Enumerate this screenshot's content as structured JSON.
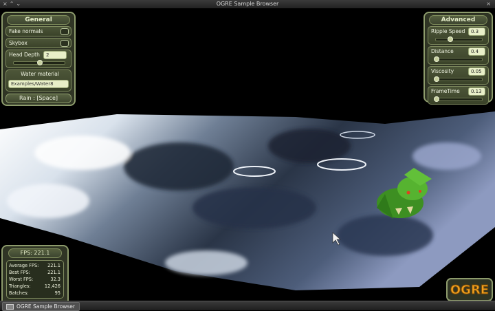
{
  "window": {
    "title": "OGRE Sample Browser"
  },
  "general": {
    "title": "General",
    "fake_normals": {
      "label": "Fake normals",
      "checked": false
    },
    "skybox": {
      "label": "Skybox",
      "checked": false
    },
    "head_depth": {
      "label": "Head Depth",
      "value": "2",
      "level": 0.5
    },
    "water_material": {
      "label": "Water material",
      "value": "Examples/Water8"
    },
    "rain_button": "Rain : [Space]"
  },
  "advanced": {
    "title": "Advanced",
    "ripple_speed": {
      "label": "Ripple Speed",
      "value": "0.3",
      "level": 0.3
    },
    "distance": {
      "label": "Distance",
      "value": "0.4",
      "level": 0.0
    },
    "viscosity": {
      "label": "Viscosity",
      "value": "0.05",
      "level": 0.0
    },
    "frame_time": {
      "label": "FrameTime",
      "value": "0.13",
      "level": 0.0
    }
  },
  "stats": {
    "fps": "FPS: 221.1",
    "average_label": "Average FPS:",
    "average_value": "221.1",
    "best_label": "Best FPS:",
    "best_value": "221.1",
    "worst_label": "Worst FPS:",
    "worst_value": "32.3",
    "triangles_label": "Triangles:",
    "triangles_value": "12,426",
    "batches_label": "Batches:",
    "batches_value": "95"
  },
  "logo": {
    "text": "OGRE"
  },
  "taskbar": {
    "item": "OGRE Sample Browser"
  },
  "colors": {
    "panel_bg": "#343a28",
    "panel_border": "#8d9b6c",
    "field_bg": "#e8efc8",
    "text": "#f2f6e4"
  }
}
